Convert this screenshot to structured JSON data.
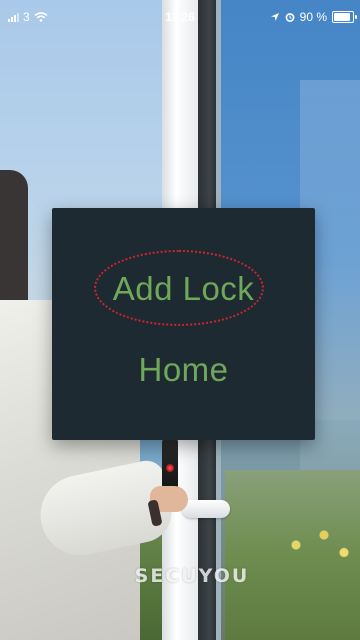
{
  "status_bar": {
    "carrier": "3",
    "time": "11.26",
    "battery_percent_text": "90 %",
    "battery_level": 0.9,
    "icons": [
      "signal-icon",
      "wifi-icon",
      "location-arrow-icon",
      "alarm-icon",
      "battery-icon"
    ]
  },
  "menu": {
    "items": [
      {
        "label": "Add Lock"
      },
      {
        "label": "Home"
      }
    ],
    "text_color": "#6fa85a",
    "background_color": "#1e2a31",
    "highlight_ring_color": "#d0242b"
  },
  "brand": {
    "watermark": "SECUYOU"
  }
}
